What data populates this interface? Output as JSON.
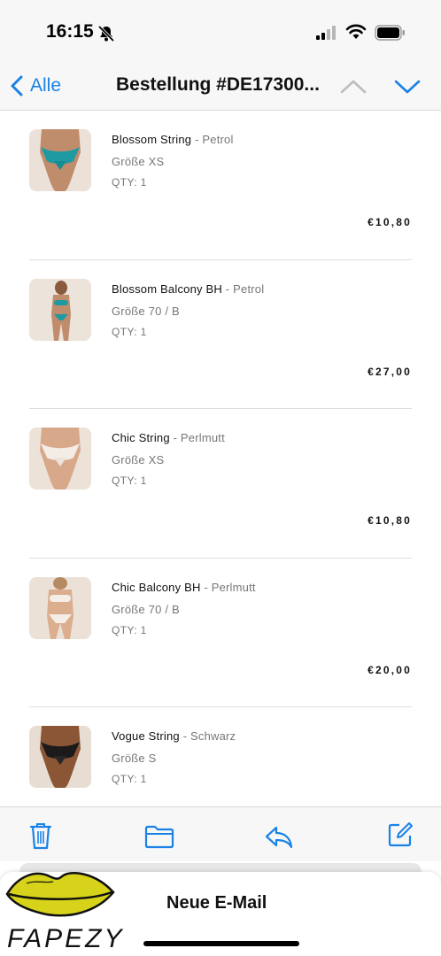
{
  "status_bar": {
    "time": "16:15",
    "icons": [
      "bell-slash-icon",
      "signal-icon",
      "wifi-icon",
      "battery-icon"
    ]
  },
  "nav": {
    "back_label": "Alle",
    "title": "Bestellung #DE17300...",
    "icons": [
      "chevron-left-icon",
      "chevron-up-icon",
      "chevron-down-icon"
    ]
  },
  "items": [
    {
      "name": "Blossom String",
      "variant": "- Petrol",
      "size": "Größe XS",
      "qty": "QTY: 1",
      "price": "€10,80"
    },
    {
      "name": "Blossom Balcony BH",
      "variant": "- Petrol",
      "size": "Größe 70 / B",
      "qty": "QTY: 1",
      "price": "€27,00"
    },
    {
      "name": "Chic String",
      "variant": "- Perlmutt",
      "size": "Größe XS",
      "qty": "QTY: 1",
      "price": "€10,80"
    },
    {
      "name": "Chic Balcony BH",
      "variant": "- Perlmutt",
      "size": "Größe 70 / B",
      "qty": "QTY: 1",
      "price": "€20,00"
    },
    {
      "name": "Vogue String",
      "variant": "- Schwarz",
      "size": "Größe S",
      "qty": "QTY: 1",
      "price": ""
    }
  ],
  "toolbar": {
    "icons": [
      "trash-icon",
      "folder-icon",
      "reply-icon",
      "compose-icon"
    ]
  },
  "compose": {
    "title": "Neue E-Mail",
    "logo_text": "FAPEZY"
  },
  "colors": {
    "accent": "#1a82e6",
    "secondary_text": "#777777",
    "bar_background": "#f7f7f7"
  }
}
